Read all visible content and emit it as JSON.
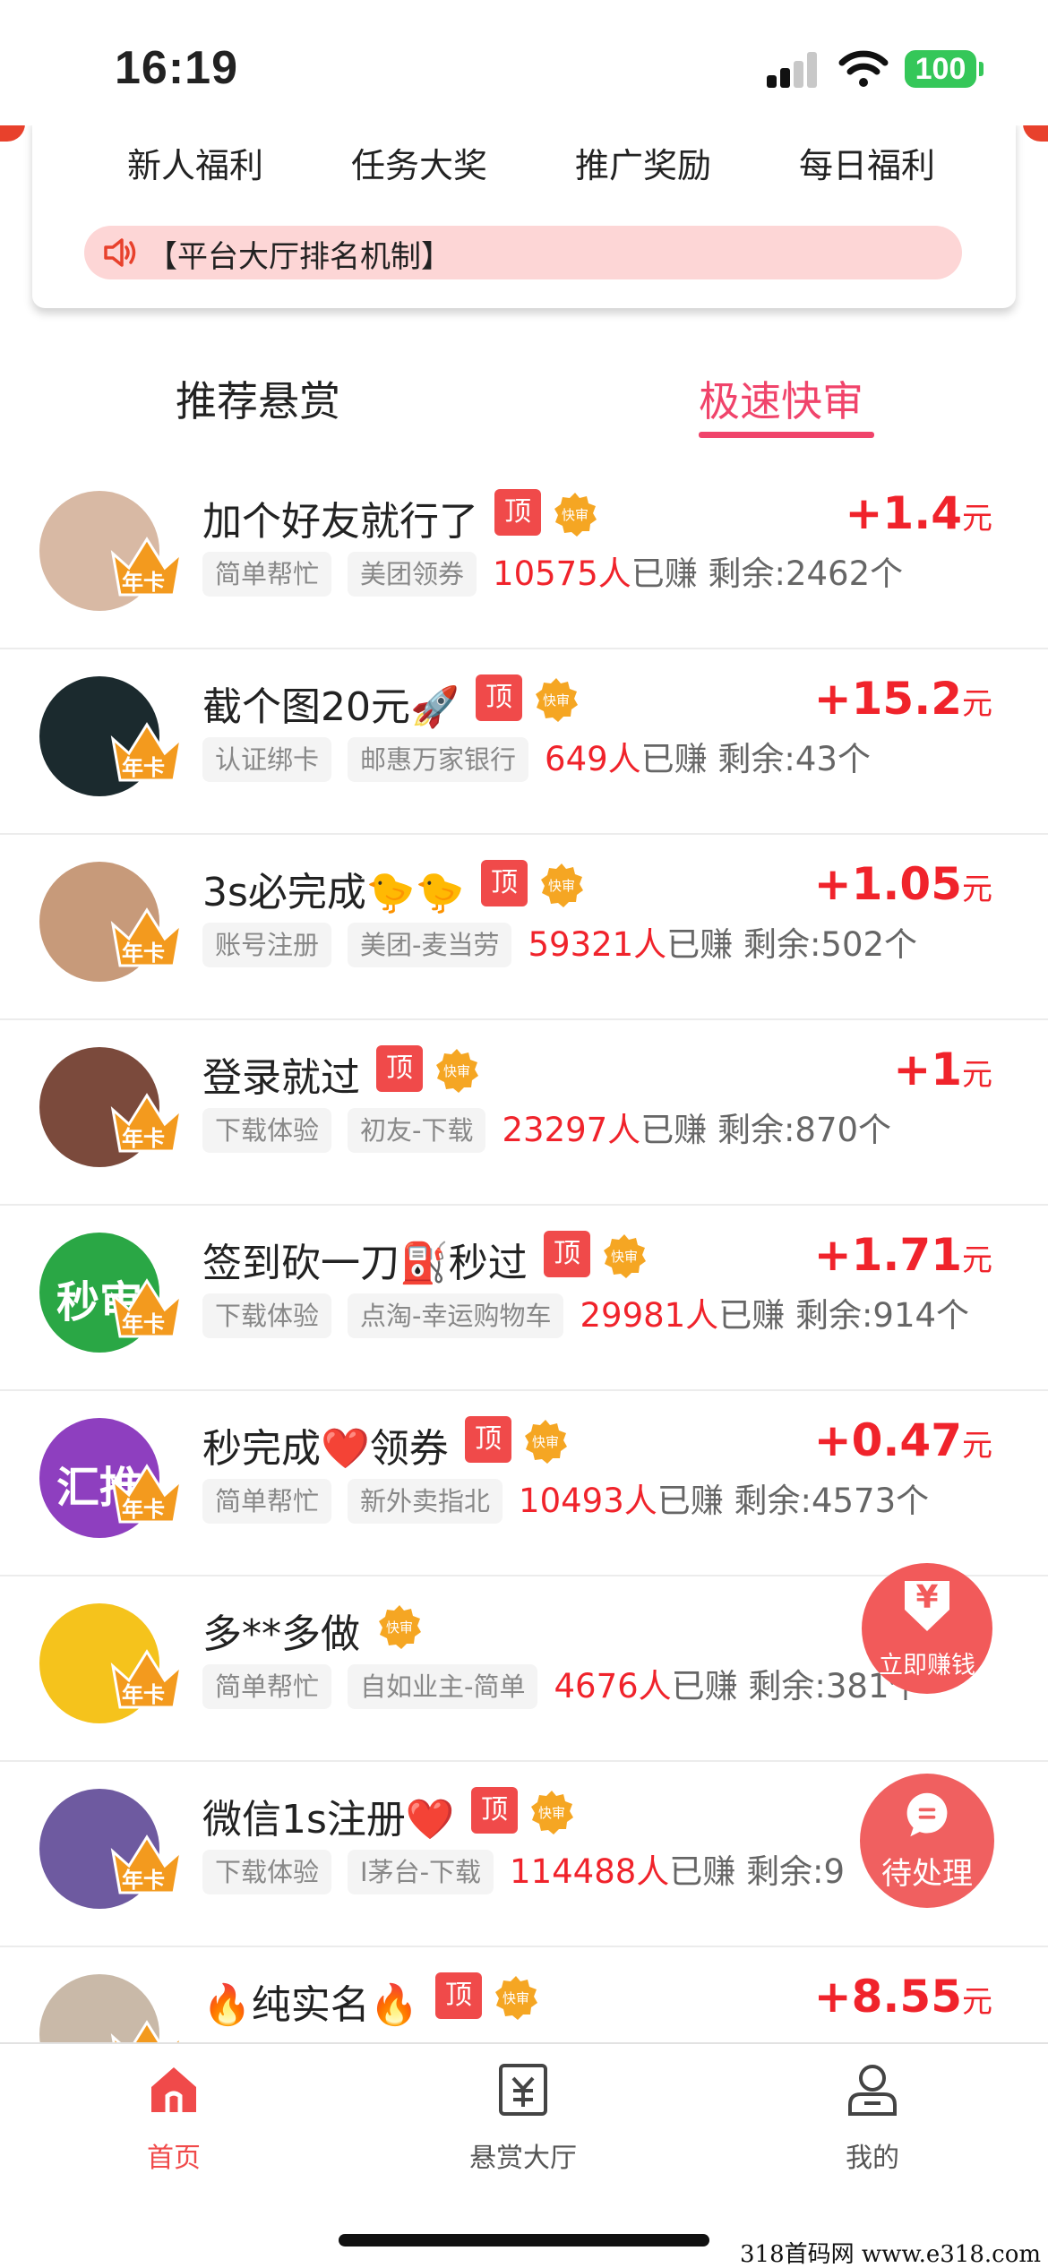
{
  "status_bar": {
    "time": "16:19",
    "battery": "100"
  },
  "top_menu": [
    "新人福利",
    "任务大奖",
    "推广奖励",
    "每日福利"
  ],
  "notice": {
    "text": "【平台大厅排名机制】",
    "icon": "speaker-icon"
  },
  "tabs": {
    "left": "推荐悬赏",
    "right": "极速快审"
  },
  "labels": {
    "top_badge": "顶",
    "fast_badge": "快审",
    "earned": "已赚",
    "crown": "年卡",
    "currency": "元"
  },
  "items": [
    {
      "title": "加个好友就行了",
      "top": true,
      "fast": true,
      "reward": "+1.4",
      "tags": [
        "简单帮忙",
        "美团领券"
      ],
      "count": "10575人",
      "remain": "剩余:2462个",
      "avatar_color": "#d8b9a4"
    },
    {
      "title": "截个图20元🚀",
      "top": true,
      "fast": true,
      "reward": "+15.2",
      "tags": [
        "认证绑卡",
        "邮惠万家银行"
      ],
      "count": "649人",
      "remain": "剩余:43个",
      "avatar_color": "#1b2a2e"
    },
    {
      "title": "3s必完成🐤🐤",
      "top": true,
      "fast": true,
      "reward": "+1.05",
      "tags": [
        "账号注册",
        "美团-麦当劳"
      ],
      "count": "59321人",
      "remain": "剩余:502个",
      "avatar_color": "#c79a7a"
    },
    {
      "title": "登录就过",
      "top": true,
      "fast": true,
      "reward": "+1",
      "tags": [
        "下载体验",
        "初友-下载"
      ],
      "count": "23297人",
      "remain": "剩余:870个",
      "avatar_color": "#7b4a3c"
    },
    {
      "title": "签到砍一刀⛽秒过",
      "top": true,
      "fast": true,
      "reward": "+1.71",
      "tags": [
        "下载体验",
        "点淘-幸运购物车"
      ],
      "count": "29981人",
      "remain": "剩余:914个",
      "avatar_color": "#2aa745",
      "avatar_text": "秒审"
    },
    {
      "title": "秒完成❤️领券",
      "top": true,
      "fast": true,
      "reward": "+0.47",
      "tags": [
        "简单帮忙",
        "新外卖指北"
      ],
      "count": "10493人",
      "remain": "剩余:4573个",
      "avatar_color": "#8e3fbf",
      "avatar_text": "汇推"
    },
    {
      "title": "多**多做",
      "top": false,
      "fast": true,
      "reward": "",
      "tags": [
        "简单帮忙",
        "自如业主-简单"
      ],
      "count": "4676人",
      "remain": "剩余:381个",
      "avatar_color": "#f5c31c"
    },
    {
      "title": "微信1s注册❤️",
      "top": true,
      "fast": true,
      "reward": "",
      "tags": [
        "下载体验",
        "I茅台-下载"
      ],
      "count": "114488人",
      "remain": "剩余:9",
      "avatar_color": "#6e5aa0"
    },
    {
      "title": "🔥纯实名🔥",
      "top": true,
      "fast": true,
      "reward": "+8.55",
      "tags": [],
      "count": "",
      "remain": "",
      "avatar_color": "#c9b9a8"
    }
  ],
  "fab": {
    "earn": "立即赚钱",
    "earn_symbol": "¥",
    "pending": "待处理"
  },
  "bottom_nav": [
    {
      "label": "首页",
      "icon": "home-icon",
      "active": true
    },
    {
      "label": "悬赏大厅",
      "icon": "reward-hall-icon",
      "active": false
    },
    {
      "label": "我的",
      "icon": "profile-icon",
      "active": false
    }
  ],
  "watermark": "318首码网  www.e318.com",
  "colors": {
    "accent": "#f0446b",
    "reward": "#f0232b",
    "badge": "#f04a4a",
    "fast": "#f5a623"
  }
}
